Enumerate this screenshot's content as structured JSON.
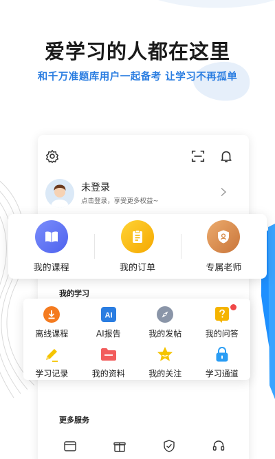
{
  "promo": {
    "headline": "爱学习的人都在这里",
    "subline": "和千万准题库用户一起备考 让学习不再孤单"
  },
  "profile": {
    "title": "未登录",
    "subtitle": "点击登录，享受更多权益~"
  },
  "quick_actions": [
    {
      "label": "我的课程",
      "icon": "book-icon",
      "color": "#5b6ff5"
    },
    {
      "label": "我的订单",
      "icon": "clipboard-icon",
      "color": "#f5b400"
    },
    {
      "label": "专属老师",
      "icon": "shield-teacher-icon",
      "color": "#d98c4a"
    }
  ],
  "my_study": {
    "title": "我的学习",
    "items": [
      {
        "label": "离线课程",
        "icon": "download-icon",
        "color": "#f47b20"
      },
      {
        "label": "AI报告",
        "icon": "ai-report-icon",
        "color": "#2a7de1"
      },
      {
        "label": "我的发帖",
        "icon": "compass-icon",
        "color": "#6c7a8e"
      },
      {
        "label": "我的问答",
        "icon": "question-icon",
        "color": "#f5b400",
        "badge": true
      },
      {
        "label": "学习记录",
        "icon": "pencil-icon",
        "color": "#f5c400"
      },
      {
        "label": "我的资料",
        "icon": "folder-icon",
        "color": "#f25c5c"
      },
      {
        "label": "我的关注",
        "icon": "star-icon",
        "color": "#f5c400"
      },
      {
        "label": "学习通道",
        "icon": "lock-icon",
        "color": "#2a9df4"
      }
    ]
  },
  "more_services": {
    "title": "更多服务",
    "icons": [
      "wallet-icon",
      "gift-icon",
      "verified-icon",
      "headset-icon"
    ]
  },
  "colors": {
    "accent_blue": "#2a7de1",
    "background": "#ffffff"
  }
}
